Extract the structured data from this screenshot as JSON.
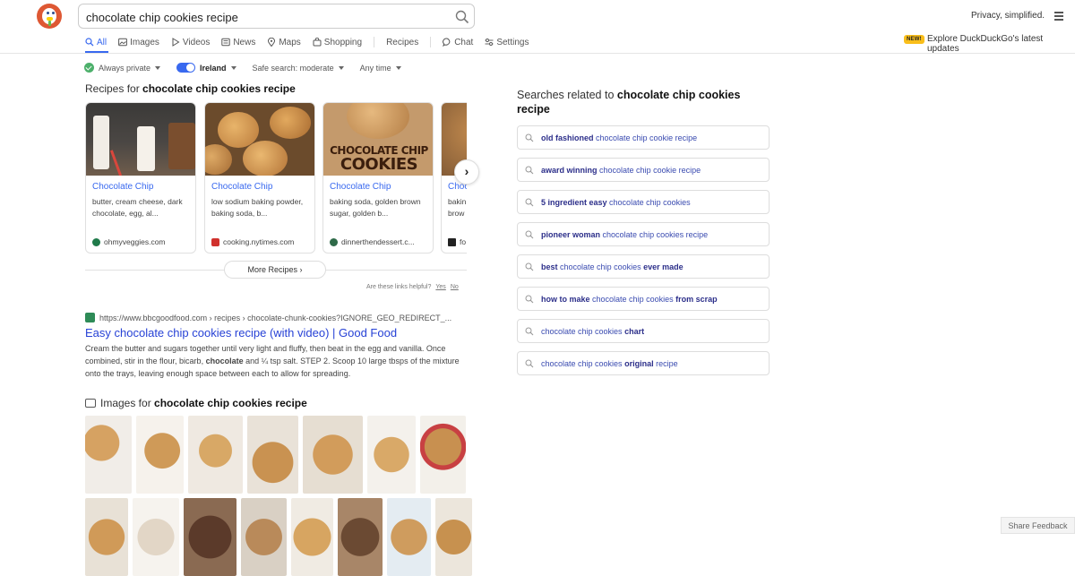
{
  "header": {
    "search_query": "chocolate chip cookies recipe",
    "privacy": "Privacy, simplified.",
    "new_badge": "NEW!",
    "explore": "Explore DuckDuckGo's latest updates"
  },
  "tabs": [
    "All",
    "Images",
    "Videos",
    "News",
    "Maps",
    "Shopping",
    "Recipes",
    "Chat",
    "Settings"
  ],
  "filters": {
    "private": "Always private",
    "region": "Ireland",
    "safe": "Safe search: moderate",
    "time": "Any time"
  },
  "recipes": {
    "title_prefix": "Recipes for",
    "title_query": "chocolate chip cookies recipe",
    "cards": [
      {
        "title": "Chocolate Chip",
        "desc": "butter, cream cheese, dark chocolate, egg, al...",
        "source": "ohmyveggies.com"
      },
      {
        "title": "Chocolate Chip",
        "desc": "low sodium baking powder, baking soda, b...",
        "source": "cooking.nytimes.com"
      },
      {
        "title": "Chocolate Chip",
        "desc": "baking soda, golden brown sugar, golden b...",
        "source": "dinnerthendessert.c..."
      },
      {
        "title": "Choc",
        "desc": "bakin brow",
        "source": "fo"
      }
    ],
    "image_text_line1": "CHOCOLATE CHIP",
    "image_text_line2": "COOKIES",
    "more": "More Recipes",
    "helpful": "Are these links helpful?",
    "yes": "Yes",
    "no": "No"
  },
  "result": {
    "url": "https://www.bbcgoodfood.com › recipes › chocolate-chunk-cookies?IGNORE_GEO_REDIRECT_...",
    "title": "Easy chocolate chip cookies recipe (with video) | Good Food",
    "snippet_a": "Cream the butter and sugars together until very light and fluffy, then beat in the egg and vanilla. Once combined, stir in the flour, bicarb,",
    "snippet_bold": "chocolate",
    "snippet_b": "and ¼ tsp salt. STEP 2. Scoop 10 large tbsps of the mixture onto the trays, leaving enough space between each to allow for spreading."
  },
  "images": {
    "title_prefix": "Images for",
    "title_query": "chocolate chip cookies recipe"
  },
  "related": {
    "title_prefix": "Searches related to",
    "title_query": "chocolate chip cookies recipe",
    "items": [
      {
        "a": "old fashioned",
        "b": "chocolate chip cookie recipe",
        "c": ""
      },
      {
        "a": "award winning",
        "b": "chocolate chip cookie recipe",
        "c": ""
      },
      {
        "a": "5 ingredient easy",
        "b": "chocolate chip cookies",
        "c": ""
      },
      {
        "a": "pioneer woman",
        "b": "chocolate chip cookies recipe",
        "c": ""
      },
      {
        "a": "best",
        "b": "chocolate chip cookies",
        "c": "ever made"
      },
      {
        "a": "how to make",
        "b": "chocolate chip cookies",
        "c": "from scrap"
      },
      {
        "a": "",
        "b": "chocolate chip cookies",
        "c": "chart"
      },
      {
        "a": "",
        "b": "chocolate chip cookies",
        "c": "original",
        "d": "recipe"
      }
    ]
  },
  "feedback": "Share Feedback"
}
